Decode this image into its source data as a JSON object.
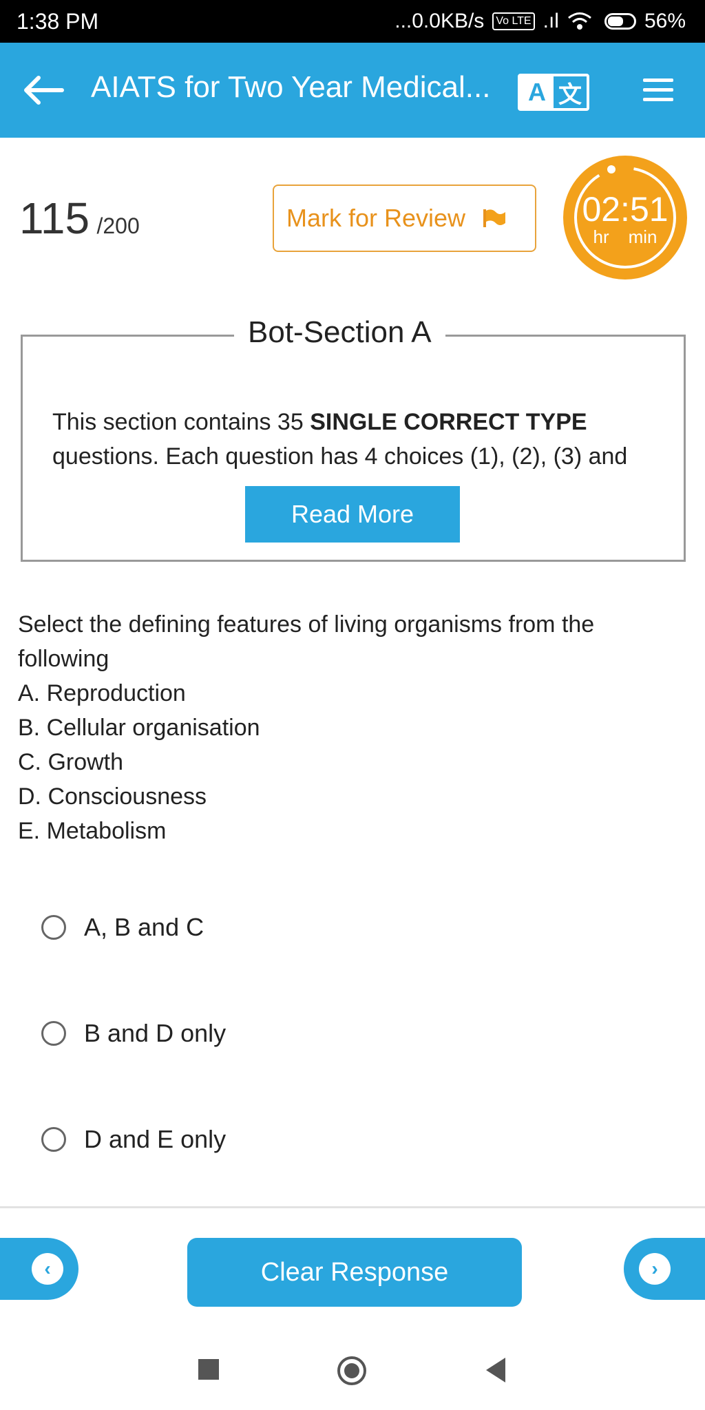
{
  "status_bar": {
    "time": "1:38 PM",
    "network": "...0.0KB/s",
    "volte": "Vo LTE",
    "signal": ".ıl",
    "battery": "56%"
  },
  "app_bar": {
    "title": "AIATS for Two Year Medical...",
    "lang_a": "A",
    "lang_b": "文",
    "color": "#2aa6de"
  },
  "score": {
    "value": "115",
    "total": "/200"
  },
  "mark_review": {
    "label": "Mark for Review",
    "color": "#e8921c"
  },
  "timer": {
    "value": "02:51",
    "hr": "hr",
    "min": "min",
    "color": "#f3a11b"
  },
  "section": {
    "title": "Bot-Section A",
    "desc_pre": "This section contains 35 ",
    "desc_bold": "SINGLE CORRECT TYPE",
    "desc_post": " questions. Each question has 4 choices (1), (2), (3) and",
    "read_more": "Read More"
  },
  "question": {
    "text": "Select the defining features of living organisms from the following",
    "items": [
      "A. Reproduction",
      "B. Cellular organisation",
      "C. Growth",
      "D. Consciousness",
      "E. Metabolism"
    ]
  },
  "options": [
    "A, B and C",
    "B and D only",
    "D and E only"
  ],
  "bottom_nav": {
    "prev": "‹",
    "next": "›",
    "clear": "Clear Response"
  }
}
